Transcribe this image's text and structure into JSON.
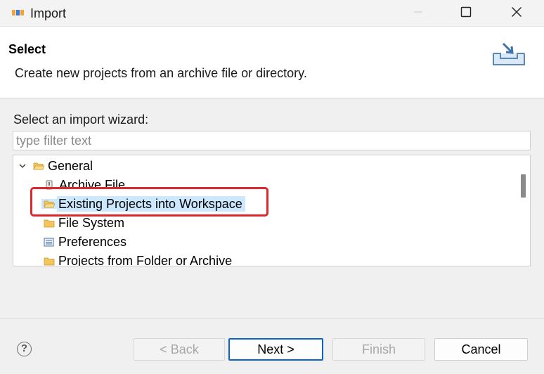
{
  "window": {
    "title": "Import",
    "app_icon": "eclipse-ide-icon",
    "controls": [
      "minimize",
      "maximize",
      "close"
    ]
  },
  "header": {
    "title": "Select",
    "description": "Create new projects from an archive file or directory.",
    "icon": "import-tray-icon"
  },
  "wizard": {
    "label": "Select an import wizard:",
    "filter_placeholder": "type filter text",
    "filter_value": ""
  },
  "tree": {
    "category": {
      "label": "General",
      "expanded": true,
      "icon": "folder-open-icon"
    },
    "items": [
      {
        "label": "Archive File",
        "icon": "archive-file-icon",
        "selected": false
      },
      {
        "label": "Existing Projects into Workspace",
        "icon": "project-folder-icon",
        "selected": true
      },
      {
        "label": "File System",
        "icon": "folder-icon",
        "selected": false
      },
      {
        "label": "Preferences",
        "icon": "preferences-icon",
        "selected": false
      },
      {
        "label": "Projects from Folder or Archive",
        "icon": "folder-icon",
        "selected": false
      }
    ]
  },
  "buttons": {
    "back": "< Back",
    "next": "Next >",
    "finish": "Finish",
    "cancel": "Cancel",
    "help": "?"
  },
  "colors": {
    "selection_bg": "#cce8ff",
    "highlight_border": "#e0282b",
    "primary_border": "#0a64c8"
  }
}
